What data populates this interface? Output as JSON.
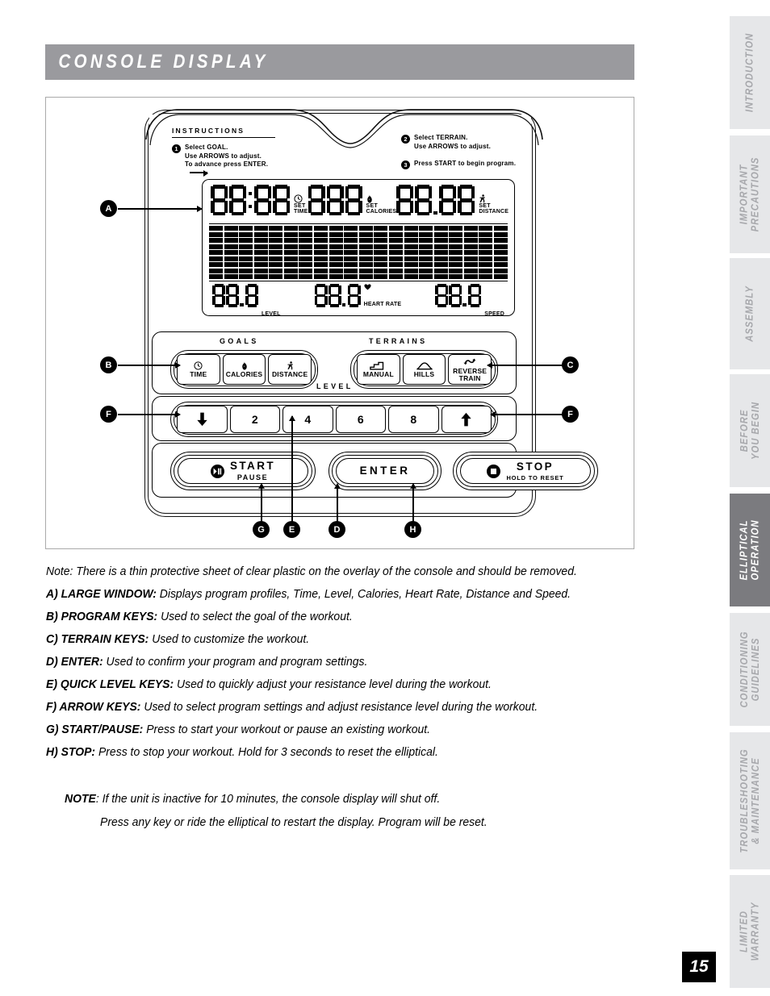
{
  "header": {
    "title": "CONSOLE DISPLAY"
  },
  "console": {
    "instructions": {
      "heading": "INSTRUCTIONS",
      "steps": [
        {
          "num": "1",
          "lines": [
            "Select GOAL.",
            "Use ARROWS to adjust.",
            "To advance press ENTER."
          ]
        },
        {
          "num": "2",
          "lines": [
            "Select TERRAIN.",
            "Use ARROWS to adjust."
          ]
        },
        {
          "num": "3",
          "lines": [
            "Press START to begin program."
          ]
        }
      ]
    },
    "lcd": {
      "top_fields": [
        {
          "icon": "clock-icon",
          "glyph": "◴",
          "set": "SET",
          "name": "TIME",
          "value": "88:88"
        },
        {
          "icon": "flame-icon",
          "glyph": "♣",
          "set": "SET",
          "name": "CALORIES",
          "value": "888"
        },
        {
          "icon": "runner-icon",
          "glyph": "☵",
          "set": "SET",
          "name": "DISTANCE",
          "value": "88.88"
        }
      ],
      "bottom_fields": [
        {
          "icon": "",
          "glyph": "",
          "name": "LEVEL",
          "value": "88.8"
        },
        {
          "icon": "heart-icon",
          "glyph": "♥",
          "name": "HEART RATE",
          "value": "88.8"
        },
        {
          "icon": "",
          "glyph": "",
          "name": "SPEED",
          "value": "88.8"
        }
      ],
      "matrix": {
        "rows": 9,
        "cols": 20
      }
    },
    "goals": {
      "title": "GOALS",
      "keys": [
        {
          "icon": "clock-icon",
          "glyph": "◴",
          "label": "TIME"
        },
        {
          "icon": "flame-icon",
          "glyph": "♣",
          "label": "CALORIES"
        },
        {
          "icon": "runner-icon",
          "glyph": "☵",
          "label": "DISTANCE"
        }
      ]
    },
    "terrains": {
      "title": "TERRAINS",
      "keys": [
        {
          "icon": "steps-icon",
          "label": "MANUAL"
        },
        {
          "icon": "hill-icon",
          "label": "HILLS"
        },
        {
          "icon": "reverse-loop-icon",
          "label": "REVERSE\nTRAIN",
          "label_line1": "REVERSE",
          "label_line2": "TRAIN"
        }
      ]
    },
    "level": {
      "title": "LEVEL",
      "keys": [
        {
          "icon": "arrow-down-icon",
          "label": ""
        },
        {
          "icon": "",
          "label": "2"
        },
        {
          "icon": "",
          "label": "4"
        },
        {
          "icon": "",
          "label": "6"
        },
        {
          "icon": "",
          "label": "8"
        },
        {
          "icon": "arrow-up-icon",
          "label": ""
        }
      ]
    },
    "actions": [
      {
        "icon": "play-pause-icon",
        "label": "START",
        "sub": "PAUSE"
      },
      {
        "icon": "",
        "label": "ENTER",
        "sub": ""
      },
      {
        "icon": "stop-icon",
        "label": "STOP",
        "sub": "HOLD TO RESET"
      }
    ],
    "callouts": [
      "A",
      "B",
      "C",
      "F",
      "F",
      "G",
      "E",
      "D",
      "H"
    ]
  },
  "body": {
    "note_line": "Note: There is a thin protective sheet of clear plastic on the overlay of the console and should be removed.",
    "items": [
      {
        "key": "A) LARGE WINDOW:",
        "text": " Displays program profiles, Time, Level, Calories, Heart Rate, Distance and Speed."
      },
      {
        "key": "B) PROGRAM KEYS:",
        "text": " Used to select the goal of the workout."
      },
      {
        "key": "C) TERRAIN KEYS:",
        "text": " Used to customize the workout."
      },
      {
        "key": "D) ENTER:",
        "text": " Used to confirm your program and program settings."
      },
      {
        "key": "E) QUICK LEVEL KEYS:",
        "text": " Used to quickly adjust your resistance level during the workout."
      },
      {
        "key": "F) ARROW KEYS:",
        "text": " Used to select program settings and adjust resistance level during the workout."
      },
      {
        "key": "G) START/PAUSE:",
        "text": " Press to start your workout or pause an existing workout."
      },
      {
        "key": "H) STOP:",
        "text": " Press to stop your workout. Hold for 3 seconds to reset the elliptical."
      }
    ],
    "note_block": {
      "key": "NOTE",
      "line1": ": If the unit is inactive for 10 minutes, the console display will shut off.",
      "line2": "Press any key or ride the elliptical to restart the display. Program will be reset."
    }
  },
  "sidebar": {
    "tabs": [
      {
        "label": "INTRODUCTION",
        "active": false
      },
      {
        "label": "IMPORTANT\nPRECAUTIONS",
        "l1": "IMPORTANT",
        "l2": "PRECAUTIONS",
        "active": false
      },
      {
        "label": "ASSEMBLY",
        "active": false
      },
      {
        "label": "BEFORE\nYOU BEGIN",
        "l1": "BEFORE",
        "l2": "YOU BEGIN",
        "active": false
      },
      {
        "label": "ELLIPTICAL\nOPERATION",
        "l1": "ELLIPTICAL",
        "l2": "OPERATION",
        "active": true
      },
      {
        "label": "CONDITIONING\nGUIDELINES",
        "l1": "CONDITIONING",
        "l2": "GUIDELINES",
        "active": false
      },
      {
        "label": "TROUBLESHOOTING\n& MAINTENANCE",
        "l1": "TROUBLESHOOTING",
        "l2": "& MAINTENANCE",
        "active": false
      },
      {
        "label": "LIMITED\nWARRANTY",
        "l1": "LIMITED",
        "l2": "WARRANTY",
        "active": false
      }
    ]
  },
  "page_number": "15",
  "colors": {
    "title_bar": "#9a9a9e",
    "tab_inactive": "#e6e7e9",
    "tab_active": "#7b7b7f",
    "tab_text": "#a7a8ac"
  }
}
